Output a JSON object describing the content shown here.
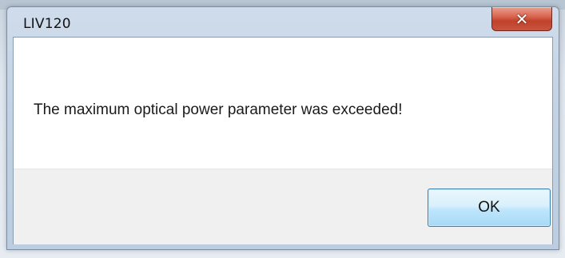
{
  "window": {
    "title": "LIV120",
    "close_icon": "close-icon",
    "close_glyph": "✕"
  },
  "dialog": {
    "message": "The maximum optical power parameter was exceeded!",
    "ok_label": "OK"
  },
  "colors": {
    "close_button": "#c9553c",
    "ok_button_border": "#3c7fb1",
    "button_area_bg": "#f0f0f0"
  }
}
